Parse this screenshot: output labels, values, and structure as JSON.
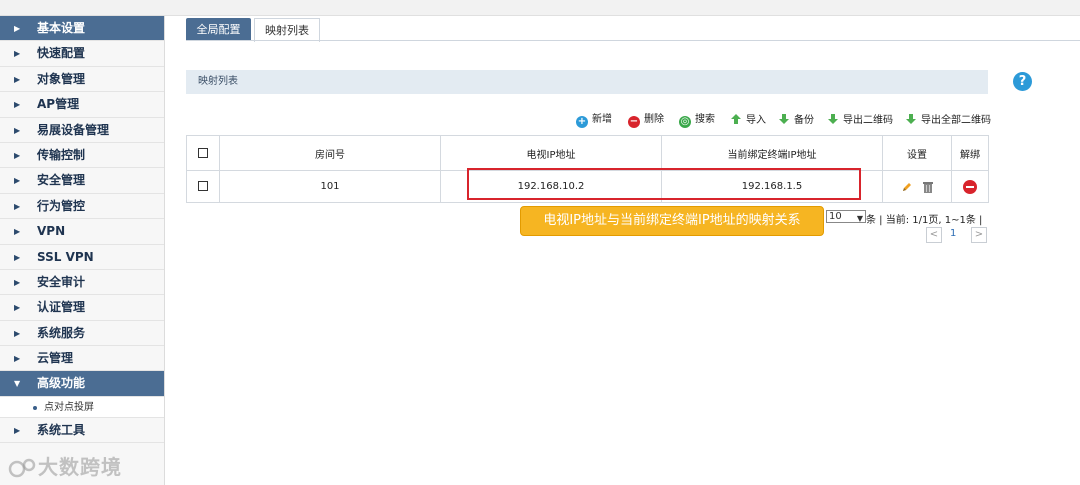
{
  "sidebar": {
    "items": [
      {
        "label": "基本设置"
      },
      {
        "label": "快速配置"
      },
      {
        "label": "对象管理"
      },
      {
        "label": "AP管理"
      },
      {
        "label": "易展设备管理"
      },
      {
        "label": "传输控制"
      },
      {
        "label": "安全管理"
      },
      {
        "label": "行为管控"
      },
      {
        "label": "VPN"
      },
      {
        "label": "SSL VPN"
      },
      {
        "label": "安全审计"
      },
      {
        "label": "认证管理"
      },
      {
        "label": "系统服务"
      },
      {
        "label": "云管理"
      },
      {
        "label": "高级功能"
      }
    ],
    "sub_item": "点对点投屏",
    "last_item": "系统工具"
  },
  "watermark": "大数跨境",
  "tabs": [
    {
      "label": "全局配置"
    },
    {
      "label": "映射列表"
    }
  ],
  "section_title": "映射列表",
  "help_label": "?",
  "toolbar": {
    "add": "新增",
    "delete": "删除",
    "search": "搜索",
    "import": "导入",
    "backup": "备份",
    "export_qr": "导出二维码",
    "export_all_qr": "导出全部二维码"
  },
  "colors": {
    "add": "#2c9ad8",
    "delete": "#d8242c",
    "search": "#3aa84a",
    "arrow_green": "#4caf50"
  },
  "table": {
    "headers": [
      "房间号",
      "电视IP地址",
      "当前绑定终端IP地址",
      "设置",
      "解绑"
    ],
    "rows": [
      {
        "room": "101",
        "tv_ip": "192.168.10.2",
        "terminal_ip": "192.168.1.5"
      }
    ]
  },
  "callout": "电视IP地址与当前绑定终端IP地址的映射关系",
  "pager": {
    "page_size": "10",
    "summary": "条 | 当前: 1/1页, 1~1条 |",
    "prev": "<",
    "page": "1",
    "next": ">"
  }
}
